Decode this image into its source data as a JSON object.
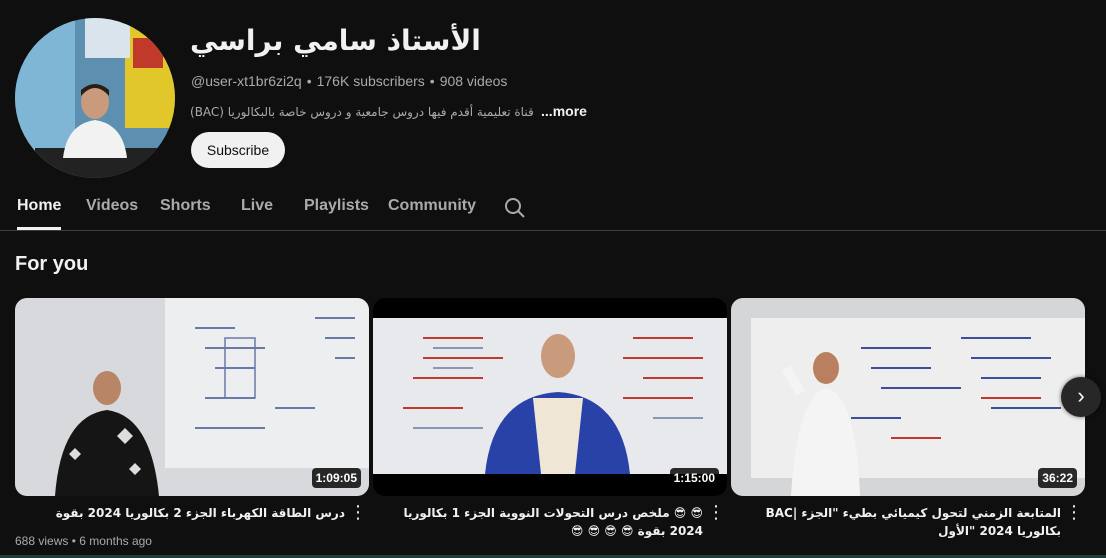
{
  "channel": {
    "name": "الأستاذ سامي براسي",
    "handle": "@user-xt1br6zi2q",
    "subscribers": "176K subscribers",
    "videos": "908 videos",
    "separator": "•",
    "description": "قناة تعليمية أقدم فيها دروس جامعية و دروس خاصة بالبكالوريا (BAC)",
    "more_label": "...more",
    "subscribe_label": "Subscribe",
    "avatar_icon": "person-avatar-icon"
  },
  "tabs": [
    {
      "label": "Home",
      "active": true
    },
    {
      "label": "Videos"
    },
    {
      "label": "Shorts"
    },
    {
      "label": "Live"
    },
    {
      "label": "Playlists"
    },
    {
      "label": "Community"
    }
  ],
  "search_icon": "search-icon",
  "section": {
    "title": "For you"
  },
  "videos": [
    {
      "title": "درس الطاقة الكهرباء الجزء 2 بكالوريا 2024 بقوة",
      "duration": "1:09:05",
      "views": "688 views",
      "age": "6 months ago"
    },
    {
      "title": "😎 😎 ملخص درس التحولات النووية الجزء 1 بكالوريا 2024 بقوة 😎 😎 😎 😎",
      "duration": "1:15:00"
    },
    {
      "title": "المتابعة الزمني لتحول كيميائي بطيء \"الجزء |BAC بكالوريا 2024 \"الأول",
      "duration": "36:22"
    }
  ],
  "next_icon": "chevron-right-icon",
  "colors": {
    "background": "#0f0f0f",
    "text": "#f1f1f1",
    "secondary": "#aaaaaa",
    "subscribe_bg": "#f1f1f1"
  }
}
